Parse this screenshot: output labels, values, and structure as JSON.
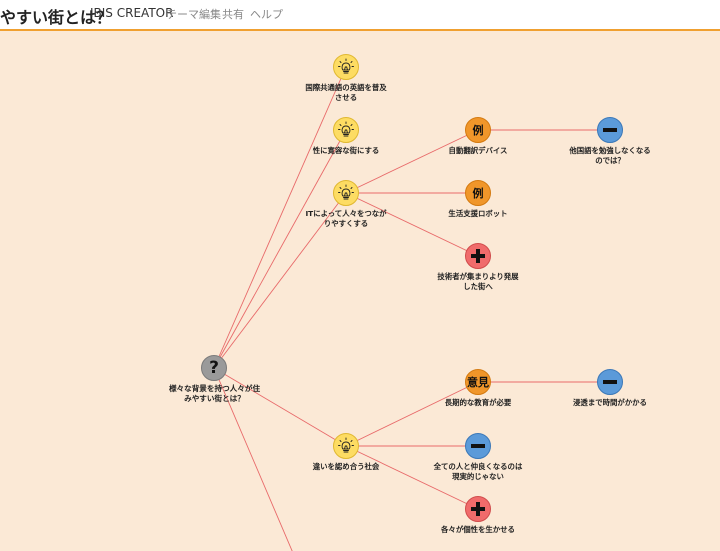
{
  "header": {
    "title": "やすい街とは？",
    "brand": "IBIS CREATOR",
    "nav": [
      "テーマ編集",
      "共有",
      "ヘルプ"
    ]
  },
  "nodes": {
    "q_root": {
      "label": "様々な背景を持つ人々が住みやすい街とは？",
      "icon": "question-mark",
      "text": "?"
    },
    "i_english": {
      "label": "国際共通語の英語を普及させる",
      "icon": "lightbulb"
    },
    "i_tolerant": {
      "label": "性に寛容な街にする",
      "icon": "lightbulb"
    },
    "i_it": {
      "label": "ITによって人々をつながりやすくする",
      "icon": "lightbulb"
    },
    "e_translate": {
      "label": "自動翻訳デバイス",
      "icon": "example",
      "text": "例"
    },
    "c_nostudy": {
      "label": "他国語を勉強しなくなるのでは？",
      "icon": "minus"
    },
    "e_robot": {
      "label": "生活支援ロボット",
      "icon": "example",
      "text": "例"
    },
    "p_tech": {
      "label": "技術者が集まりより発展した街へ",
      "icon": "plus"
    },
    "i_diversity": {
      "label": "違いを認め合う社会",
      "icon": "lightbulb"
    },
    "o_education": {
      "label": "長期的な教育が必要",
      "icon": "opinion",
      "text": "意見"
    },
    "c_time": {
      "label": "浸透まで時間がかかる",
      "icon": "minus"
    },
    "c_unreal": {
      "label": "全ての人と仲良くなるのは現実的じゃない",
      "icon": "minus"
    },
    "p_individual": {
      "label": "各々が個性を生かせる",
      "icon": "plus"
    }
  },
  "colors": {
    "background": "#fbe9d6",
    "edge": "#e86a6a",
    "accent": "#f0a030",
    "idea": "#fddc63",
    "example": "#f0962a",
    "pro": "#f06b6b",
    "con": "#5b9ad9",
    "question": "#9a9a9a"
  }
}
